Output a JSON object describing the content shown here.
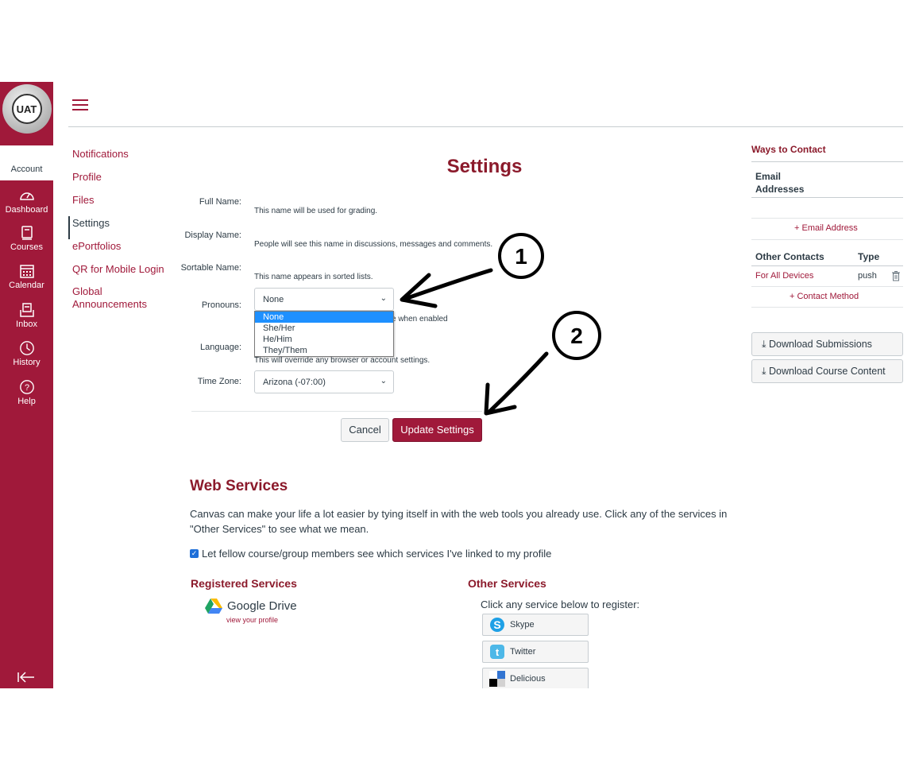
{
  "global_nav": {
    "logo_text": "UAT",
    "account_label": "Account",
    "items": [
      {
        "label": "Dashboard",
        "icon": "dashboard-icon"
      },
      {
        "label": "Courses",
        "icon": "courses-icon"
      },
      {
        "label": "Calendar",
        "icon": "calendar-icon"
      },
      {
        "label": "Inbox",
        "icon": "inbox-icon"
      },
      {
        "label": "History",
        "icon": "history-icon"
      },
      {
        "label": "Help",
        "icon": "help-icon"
      }
    ],
    "collapse_icon": "collapse-nav-icon"
  },
  "subnav": {
    "items": [
      {
        "label": "Notifications"
      },
      {
        "label": "Profile"
      },
      {
        "label": "Files"
      },
      {
        "label": "Settings",
        "active": true
      },
      {
        "label": "ePortfolios"
      },
      {
        "label": "QR for Mobile Login"
      },
      {
        "label": "Global Announcements"
      }
    ]
  },
  "main": {
    "title": "Settings",
    "fields": {
      "full_name": {
        "label": "Full Name:",
        "hint": "This name will be used for grading."
      },
      "display_name": {
        "label": "Display Name:",
        "hint": "People will see this name in discussions, messages and comments."
      },
      "sortable_name": {
        "label": "Sortable Name:",
        "hint": "This name appears in sorted lists."
      },
      "pronouns": {
        "label": "Pronouns:",
        "value": "None",
        "hint_tail": "e when enabled",
        "options": [
          "None",
          "She/Her",
          "He/Him",
          "They/Them"
        ],
        "highlighted": "None"
      },
      "language": {
        "label": "Language:",
        "hint": "This will override any browser or account settings."
      },
      "time_zone": {
        "label": "Time Zone:",
        "value": "Arizona (-07:00)"
      }
    },
    "cancel_label": "Cancel",
    "update_label": "Update Settings"
  },
  "annotations": [
    "1",
    "2"
  ],
  "web_services": {
    "title": "Web Services",
    "description": "Canvas can make your life a lot easier by tying itself in with the web tools you already use. Click any of the services in \"Other Services\" to see what we mean.",
    "checkbox_label": "Let fellow course/group members see which services I've linked to my profile",
    "checkbox_checked": true,
    "registered_title": "Registered Services",
    "registered": [
      {
        "name": "Google Drive",
        "link": "view your profile"
      }
    ],
    "other_title": "Other Services",
    "other_hint": "Click any service below to register:",
    "other": [
      {
        "name": "Skype"
      },
      {
        "name": "Twitter"
      },
      {
        "name": "Delicious"
      }
    ]
  },
  "right_sidebar": {
    "title": "Ways to Contact",
    "email_header": "Email Addresses",
    "add_email": "Email Address",
    "other_contacts_header": "Other Contacts",
    "type_header": "Type",
    "contacts": [
      {
        "name": "For All Devices",
        "type": "push"
      }
    ],
    "add_contact": "Contact Method",
    "download_submissions": "Download Submissions",
    "download_course_content": "Download Course Content"
  },
  "colors": {
    "brand": "#a0193a",
    "heading": "#8b1a2b",
    "highlight": "#1e90ff"
  }
}
